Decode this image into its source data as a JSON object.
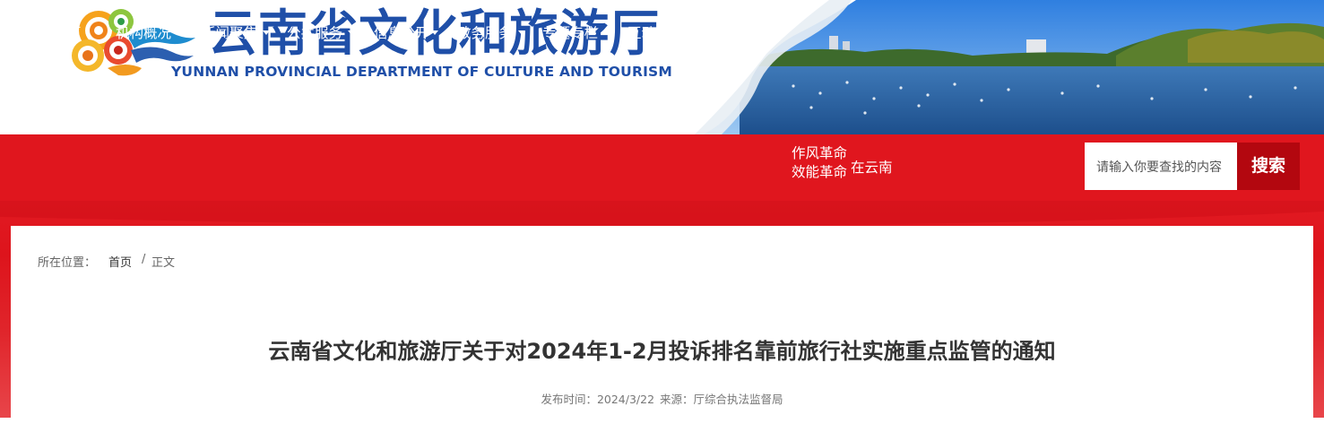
{
  "header": {
    "logo_cn": "云南省文化和旅游厅",
    "logo_en": "YUNNAN PROVINCIAL DEPARTMENT OF CULTURE AND TOURISM"
  },
  "nav": {
    "items": [
      {
        "label": "首　页",
        "dropdown": false
      },
      {
        "label": "机构概况",
        "dropdown": true
      },
      {
        "label": "新闻聚焦",
        "dropdown": true
      },
      {
        "label": "公共服务",
        "dropdown": true
      },
      {
        "label": "信息公开",
        "dropdown": true
      },
      {
        "label": "政务服务",
        "dropdown": true
      },
      {
        "label": "专题专栏",
        "dropdown": true
      },
      {
        "label": "互动交流",
        "dropdown": true
      },
      {
        "label": "主题教育",
        "dropdown": false
      }
    ],
    "special_line1": "作风革命",
    "special_line2": "效能革命",
    "special_side": "在云南"
  },
  "search": {
    "placeholder": "请输入你要查找的内容",
    "button_label": "搜索"
  },
  "breadcrumb": {
    "label": "所在位置：",
    "home": "首页",
    "separator": "/",
    "current": "正文"
  },
  "article": {
    "title": "云南省文化和旅游厅关于对2024年1-2月投诉排名靠前旅行社实施重点监管的通知",
    "publish_label": "发布时间：2024/3/22",
    "source_label": "来源：厅综合执法监督局"
  },
  "colors": {
    "nav_red": "#e0161e",
    "search_button": "#b3070f",
    "logo_blue": "#1f4fa8"
  },
  "icons": [
    "cloud-emblem-logo",
    "lake-banner-photo",
    "caret-down-icon"
  ]
}
